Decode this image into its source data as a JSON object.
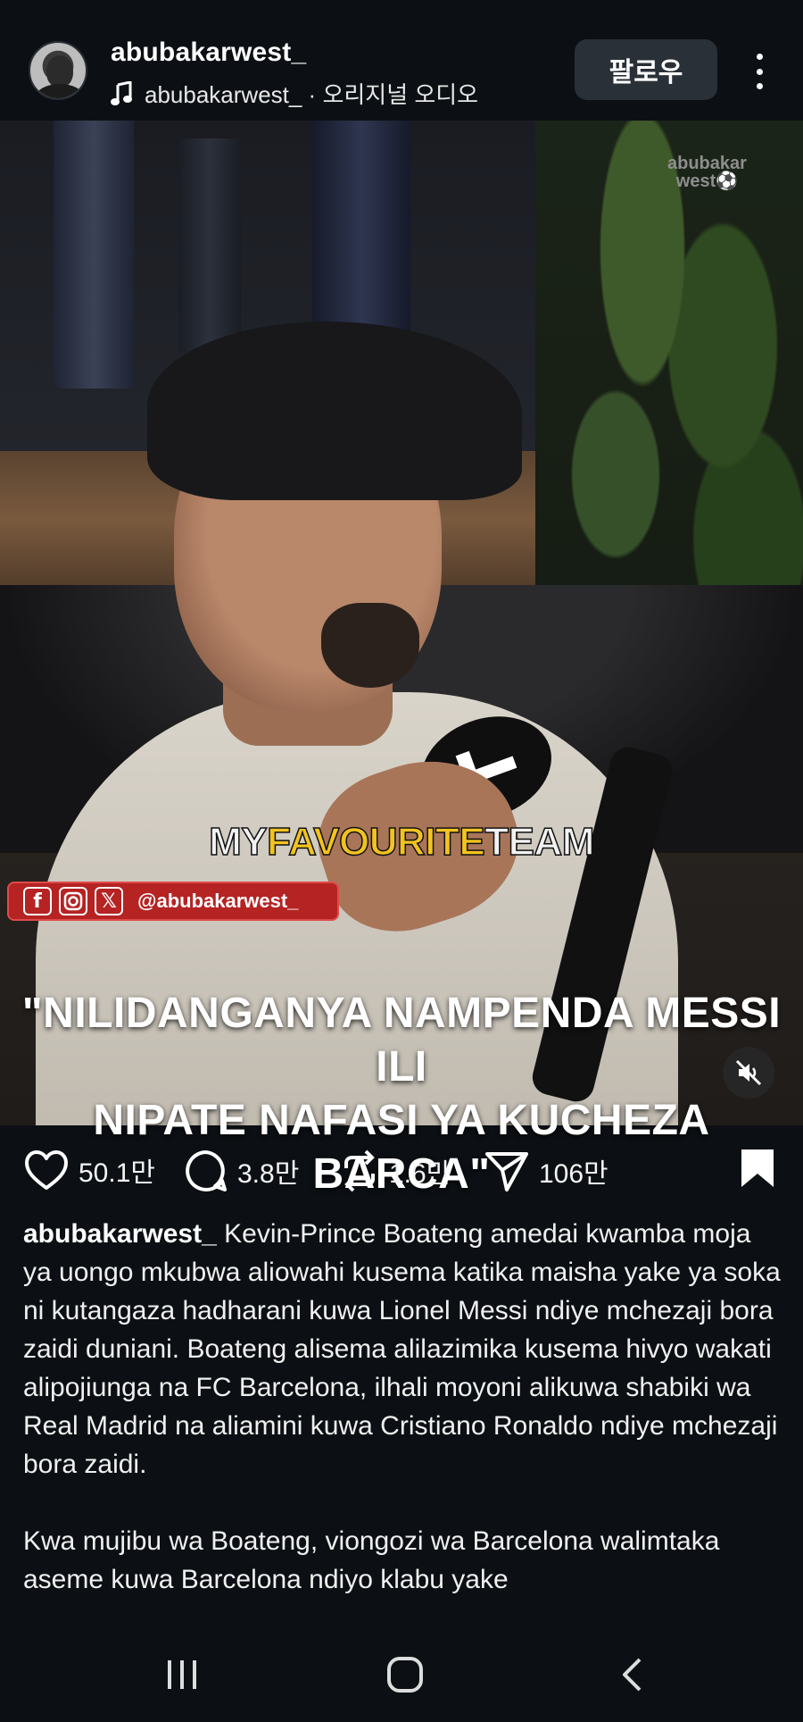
{
  "header": {
    "username": "abubakarwest_",
    "audio": "abubakarwest_ · 오리지널 오디오",
    "follow_label": "팔로우"
  },
  "video": {
    "watermark_line1": "abubakar",
    "watermark_line2": "west⚽",
    "overlay_word1": "MY",
    "overlay_word2": "FAVOURITE",
    "overlay_word3": "TEAM",
    "social_handle": "@abubakarwest_",
    "social_icons": [
      "facebook-icon",
      "instagram-icon",
      "x-icon"
    ],
    "headline_line1": "\"NILIDANGANYA NAMPENDA MESSI ILI",
    "headline_line2": "NIPATE NAFASI YA KUCHEZA BARCA\""
  },
  "actions": {
    "likes": "50.1만",
    "comments": "3.8만",
    "reposts": "1.6만",
    "shares": "106만"
  },
  "caption": {
    "username": "abubakarwest_",
    "paragraph1": "Kevin-Prince Boateng amedai kwamba moja ya uongo mkubwa aliowahi kusema katika maisha yake ya soka ni kutangaza hadharani kuwa Lionel Messi ndiye mchezaji bora zaidi duniani. Boateng alisema alilazimika kusema hivyo wakati alipojiunga na FC Barcelona, ilhali moyoni alikuwa shabiki wa Real Madrid na aliamini kuwa Cristiano Ronaldo ndiye mchezaji bora zaidi.",
    "paragraph2": "Kwa mujibu wa Boateng, viongozi wa Barcelona walimtaka aseme kuwa Barcelona ndiyo klabu yake"
  },
  "colors": {
    "background": "#0c1014",
    "follow_button": "#2a3038",
    "overlay_yellow": "#f2c320",
    "social_bar_red": "#b52323"
  }
}
